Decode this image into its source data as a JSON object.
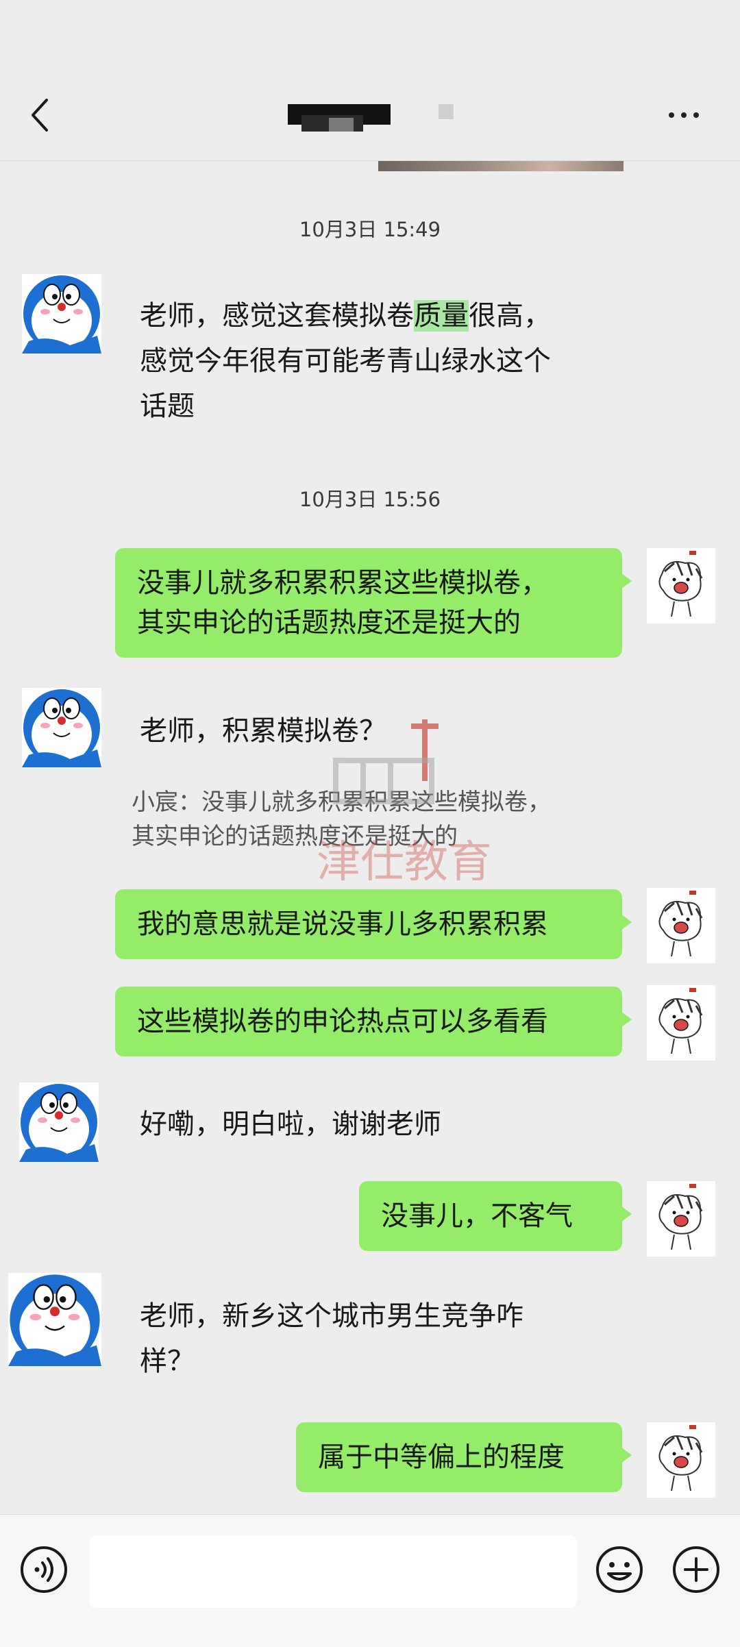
{
  "header": {
    "title": "",
    "back_icon": "chevron-left-icon",
    "more_icon": "ellipsis-icon"
  },
  "messages": {
    "ts1": "10月3日 15:49",
    "m1": {
      "pre": "老师，感觉这套模拟卷",
      "hl": "质量",
      "post": "很高，",
      "line2": "感觉今年很有可能考青山绿水这个",
      "line3": "话题"
    },
    "ts2": "10月3日 15:56",
    "m2": {
      "line1": "没事儿就多积累积累这些模拟卷，",
      "line2": "其实申论的话题热度还是挺大的"
    },
    "m3": "老师，积累模拟卷？",
    "quote": {
      "line1": "小宸：没事儿就多积累积累这些模拟卷，",
      "line2": "其实申论的话题热度还是挺大的"
    },
    "m4": "我的意思就是说没事儿多积累积累",
    "m5": "这些模拟卷的申论热点可以多看看",
    "m6": "好嘞，明白啦，谢谢老师",
    "m7": "没事儿，不客气",
    "m8": {
      "line1": "老师，新乡这个城市男生竞争咋",
      "line2": "样？"
    },
    "m9": "属于中等偏上的程度"
  },
  "watermark_text": "津仕教育",
  "input": {
    "placeholder": ""
  },
  "colors": {
    "outgoing_bubble": "#95ec69",
    "background": "#ededed",
    "highlight": "#a8e6a1"
  },
  "icons": {
    "voice": "voice-icon",
    "emoji": "emoji-icon",
    "plus": "plus-icon"
  }
}
